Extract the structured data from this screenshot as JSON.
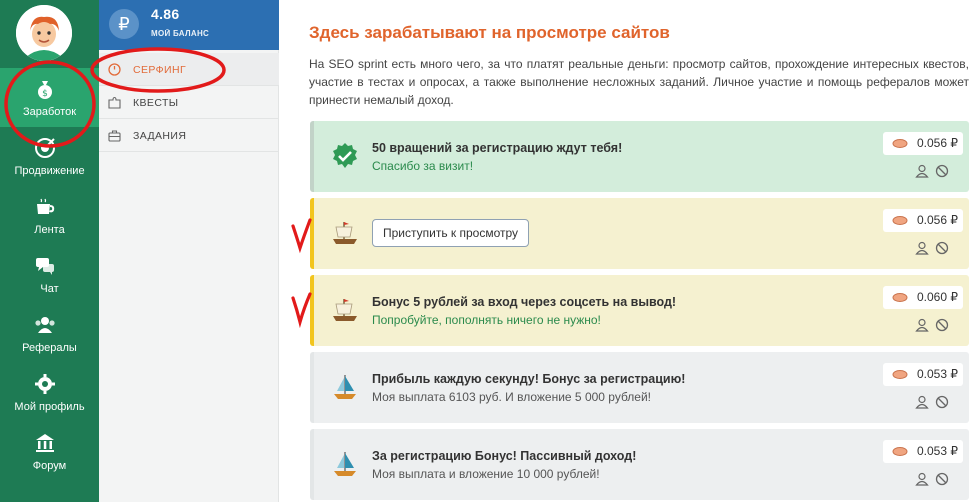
{
  "nav": {
    "items": [
      {
        "label": "Заработок",
        "icon": "money-bag-icon",
        "active": true
      },
      {
        "label": "Продвижение",
        "icon": "target-icon"
      },
      {
        "label": "Лента",
        "icon": "cup-icon"
      },
      {
        "label": "Чат",
        "icon": "chat-icon"
      },
      {
        "label": "Рефералы",
        "icon": "people-icon"
      },
      {
        "label": "Мой профиль",
        "icon": "gear-icon"
      },
      {
        "label": "Форум",
        "icon": "bank-icon"
      }
    ]
  },
  "balance": {
    "symbol": "₽",
    "value": "4.86",
    "label": "МОЙ БАЛАНС"
  },
  "subnav": {
    "items": [
      {
        "label": "СЕРФИНГ",
        "icon": "timer-icon",
        "active": true
      },
      {
        "label": "КВЕСТЫ",
        "icon": "puzzle-icon"
      },
      {
        "label": "ЗАДАНИЯ",
        "icon": "briefcase-icon"
      }
    ]
  },
  "main": {
    "title": "Здесь зарабатывают на просмотре сайтов",
    "intro": "На SEO sprint есть много чего, за что платят реальные деньги: просмотр сайтов, прохождение интересных квестов, участие в тестах и опросах, а также выполнение несложных заданий. Личное участие и помощь рефералов может принести немалый доход.",
    "cards": [
      {
        "title": "50 вращений за регистрацию ждут тебя!",
        "subtitle": "Спасибо за визит!",
        "price": "0.056 ₽",
        "style": "green",
        "icon": "check-icon"
      },
      {
        "button": "Приступить к просмотру",
        "price": "0.056 ₽",
        "style": "yellow",
        "icon": "ship-icon"
      },
      {
        "title": "Бонус 5 рублей за вход через соцсеть на вывод!",
        "subtitle": "Попробуйте, пополнять ничего не нужно!",
        "price": "0.060 ₽",
        "style": "yellow",
        "icon": "ship-icon"
      },
      {
        "title": "Прибыль каждую секунду! Бонус за регистрацию!",
        "subtitle": "Моя выплата 6103 руб. И вложение 5 000 рублей!",
        "price": "0.053 ₽",
        "style": "gray",
        "icon": "sailboat-icon"
      },
      {
        "title": "За регистрацию Бонус! Пассивный доход!",
        "subtitle": "Моя выплата и вложение 10 000 рублей!",
        "price": "0.053 ₽",
        "style": "gray",
        "icon": "sailboat-icon"
      }
    ]
  },
  "colors": {
    "nav_bg": "#1e7b54",
    "nav_active": "#2aa46e",
    "balance_bg": "#2c6fb2",
    "accent": "#e0642c",
    "highlight": "#e21a1a"
  }
}
